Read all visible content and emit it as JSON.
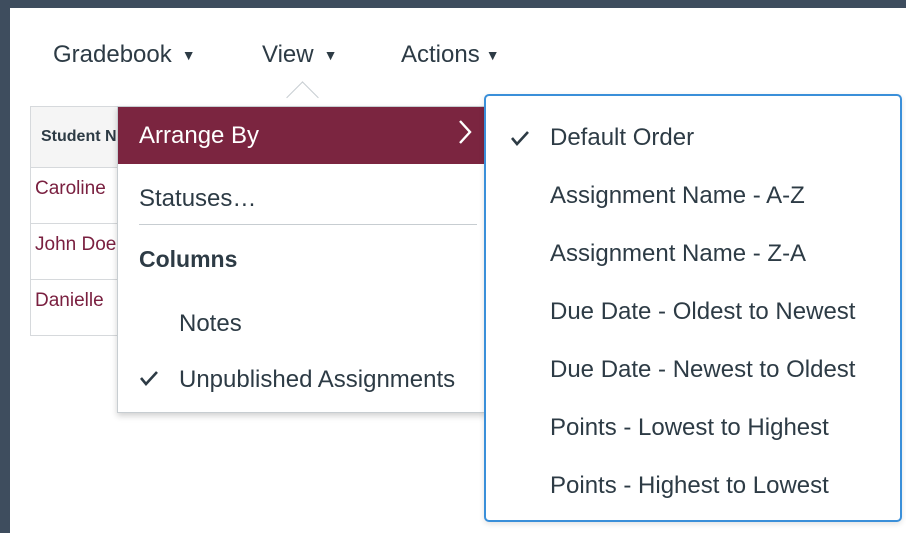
{
  "toolbar": {
    "gradebook": "Gradebook",
    "view": "View",
    "actions": "Actions",
    "caret": "▼"
  },
  "table": {
    "header": "Student Name",
    "rows": [
      "Caroline",
      "John Doe",
      "Danielle"
    ]
  },
  "view_menu": {
    "arrange_by": "Arrange By",
    "statuses": "Statuses…",
    "columns_heading": "Columns",
    "notes": "Notes",
    "unpublished": "Unpublished Assignments",
    "unpublished_checked": true
  },
  "arrange_menu": {
    "selected": "Default Order",
    "options": [
      "Default Order",
      "Assignment Name - A-Z",
      "Assignment Name - Z-A",
      "Due Date - Oldest to Newest",
      "Due Date - Newest to Oldest",
      "Points - Lowest to Highest",
      "Points - Highest to Lowest"
    ]
  },
  "colors": {
    "accent": "#7b2540",
    "focus_border": "#3a8fd9",
    "link": "#7a2040",
    "frame": "#3e4d5e"
  }
}
